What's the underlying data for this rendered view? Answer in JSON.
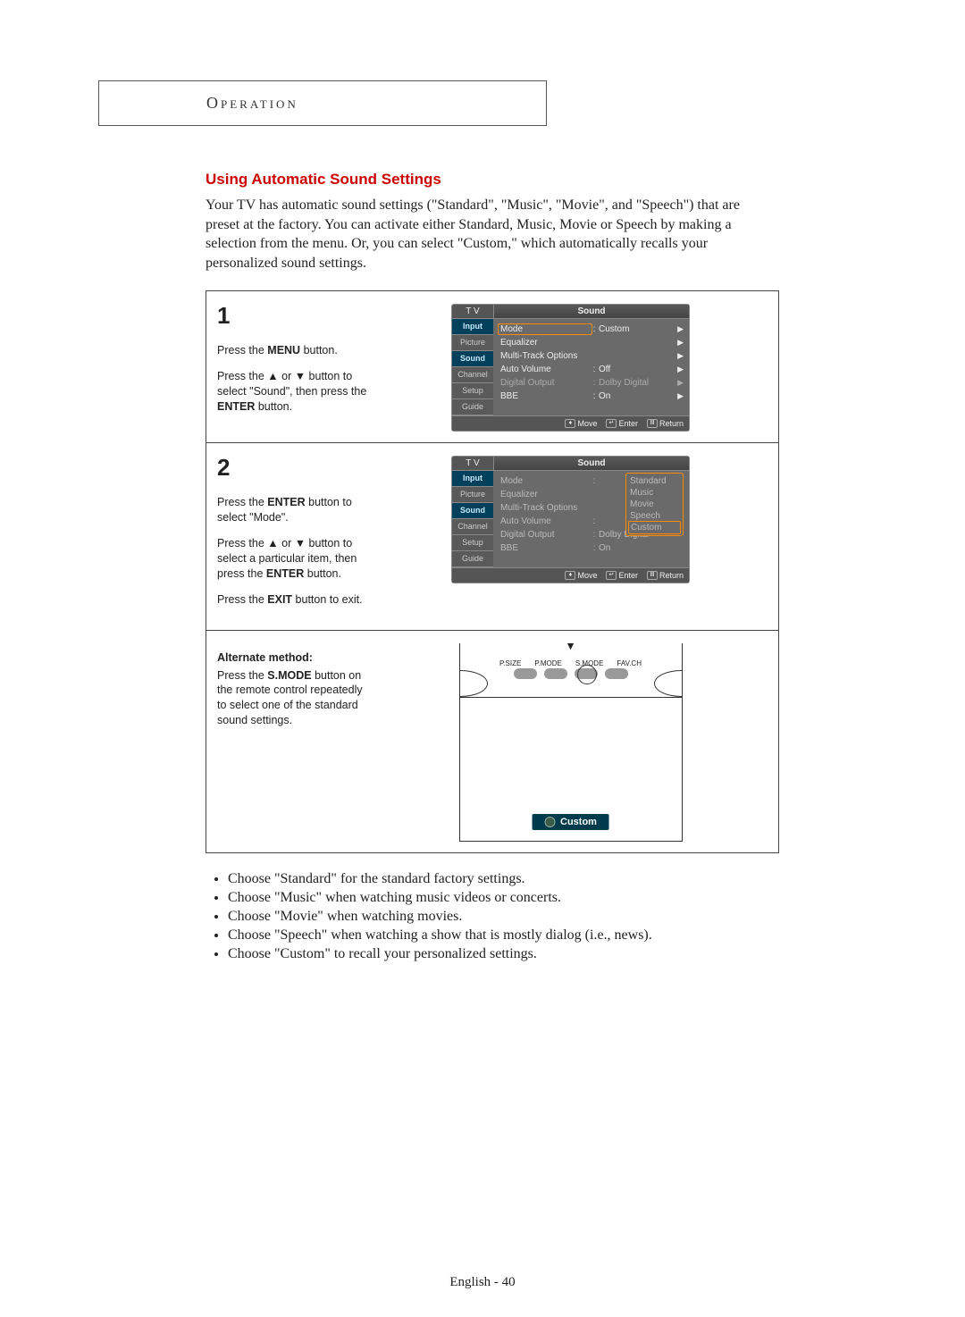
{
  "header": "Operation",
  "title": "Using Automatic Sound Settings",
  "intro": "Your TV has automatic sound settings (\"Standard\", \"Music\", \"Movie\", and \"Speech\") that are preset at the factory. You can activate either Standard, Music, Movie or Speech by making a selection from the menu. Or, you can select \"Custom,\" which automatically recalls your personalized sound settings.",
  "steps": {
    "one": {
      "num": "1",
      "p1a": "Press the ",
      "p1b": "MENU",
      "p1c": " button.",
      "p2a": "Press the ▲ or ▼ button to select \"Sound\", then press the ",
      "p2b": "ENTER",
      "p2c": " button."
    },
    "two": {
      "num": "2",
      "p1a": "Press the ",
      "p1b": "ENTER",
      "p1c": " button to select \"Mode\".",
      "p2a": "Press the ▲ or ▼ button to select a particular item, then press the ",
      "p2b": "ENTER",
      "p2c": " button.",
      "p3a": "Press the ",
      "p3b": "EXIT",
      "p3c": " button to exit."
    },
    "alt": {
      "h": "Alternate method:",
      "p1a": "Press the ",
      "p1b": "S.MODE",
      "p1c": " button on the remote control repeatedly to select one of the standard sound settings."
    }
  },
  "osd": {
    "tv": "T V",
    "title": "Sound",
    "tabs": [
      "Input",
      "Picture",
      "Sound",
      "Channel",
      "Setup",
      "Guide"
    ],
    "rows": [
      {
        "label": "Mode",
        "val": "Custom"
      },
      {
        "label": "Equalizer",
        "val": ""
      },
      {
        "label": "Multi-Track Options",
        "val": ""
      },
      {
        "label": "Auto Volume",
        "val": "Off"
      },
      {
        "label": "Digital Output",
        "val": "Dolby Digital"
      },
      {
        "label": "BBE",
        "val": "On"
      }
    ],
    "footer": {
      "move": "Move",
      "enter": "Enter",
      "return": "Return"
    }
  },
  "osd2": {
    "tv": "T V",
    "title": "Sound",
    "rows": [
      {
        "label": "Mode",
        "val": ""
      },
      {
        "label": "Equalizer",
        "val": ""
      },
      {
        "label": "Multi-Track Options",
        "val": ""
      },
      {
        "label": "Auto Volume",
        "val": ""
      },
      {
        "label": "Digital Output",
        "val": "Dolby Digital"
      },
      {
        "label": "BBE",
        "val": "On"
      }
    ],
    "dropdown": [
      "Standard",
      "Music",
      "Movie",
      "Speech",
      "Custom"
    ]
  },
  "remote": {
    "labels": [
      "P.SIZE",
      "P.MODE",
      "S.MODE",
      "FAV.CH"
    ],
    "badge": "Custom"
  },
  "bullets": [
    "Choose \"Standard\" for the standard factory settings.",
    "Choose \"Music\" when watching music videos or concerts.",
    "Choose \"Movie\" when watching movies.",
    "Choose \"Speech\" when watching a show that is mostly dialog (i.e., news).",
    "Choose \"Custom\" to recall your personalized settings."
  ],
  "footer": "English - 40"
}
